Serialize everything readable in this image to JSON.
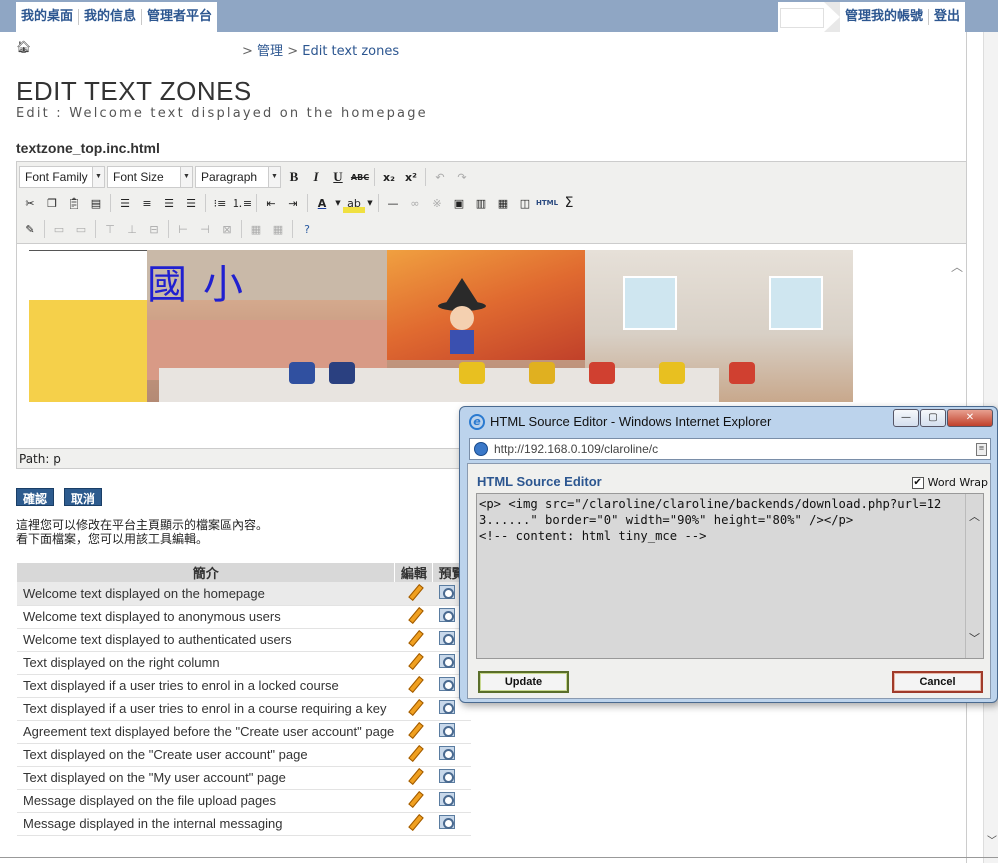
{
  "topbar": {
    "left_tabs": [
      "我的桌面",
      "我的信息",
      "管理者平台"
    ],
    "right_tabs": [
      "管理我的帳號",
      "登出"
    ]
  },
  "breadcrumb": {
    "home_icon": "home-icon",
    "items": [
      "管理",
      "Edit text zones"
    ],
    "separator": ">"
  },
  "page": {
    "title": "EDIT TEXT ZONES",
    "subtitle": "Edit : Welcome text displayed on the homepage",
    "file_name": "textzone_top.inc.html"
  },
  "editor": {
    "font_family": "Font Family",
    "font_size": "Font Size",
    "format": "Paragraph",
    "toolbar_row1": [
      "B",
      "I",
      "U",
      "ABC",
      "x₂",
      "x²"
    ],
    "html_label": "HTML",
    "sigma": "Σ",
    "banner_text": "國小",
    "path_label": "Path: p"
  },
  "buttons": {
    "confirm": "確認",
    "cancel": "取消"
  },
  "description": {
    "line1": "這裡您可以修改在平台主頁顯示的檔案區內容。",
    "line2": "看下面檔案，您可以用該工具編輯。"
  },
  "table": {
    "headers": [
      "簡介",
      "編輯",
      "預覽"
    ],
    "rows": [
      "Welcome text displayed on the homepage",
      "Welcome text displayed to anonymous users",
      "Welcome text displayed to authenticated users",
      "Text displayed on the right column",
      "Text displayed if a user tries to enrol in a locked course",
      "Text displayed if a user tries to enrol in a course requiring a key",
      "Agreement text displayed before the \"Create user account\" page",
      "Text displayed on the \"Create user account\" page",
      "Text displayed on the \"My user account\" page",
      "Message displayed on the file upload pages",
      "Message displayed in the internal messaging"
    ]
  },
  "popup": {
    "title": "HTML Source Editor - Windows Internet Explorer",
    "url": "http://192.168.0.109/claroline/c",
    "heading": "HTML Source Editor",
    "word_wrap": "Word Wrap",
    "word_wrap_checked": true,
    "source": "<p> <img src=\"/claroline/claroline/backends/download.php?url=123......\" border=\"0\" width=\"90%\" height=\"80%\" /></p>\n<!-- content: html tiny_mce -->",
    "update_label": "Update",
    "cancel_label": "Cancel"
  }
}
